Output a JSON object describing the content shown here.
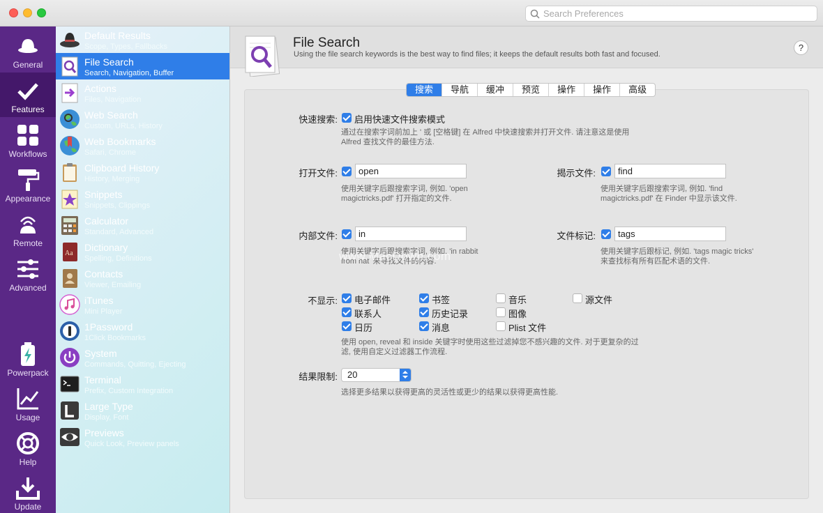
{
  "search": {
    "placeholder": "Search Preferences"
  },
  "leftbar": {
    "items": [
      {
        "label": "General",
        "icon": "hat-icon"
      },
      {
        "label": "Features",
        "icon": "checkmark-icon"
      },
      {
        "label": "Workflows",
        "icon": "grid-icon"
      },
      {
        "label": "Appearance",
        "icon": "paint-roller-icon"
      },
      {
        "label": "Remote",
        "icon": "remote-icon"
      },
      {
        "label": "Advanced",
        "icon": "sliders-icon"
      },
      {
        "label": "Powerpack",
        "icon": "battery-icon"
      },
      {
        "label": "Usage",
        "icon": "chart-icon"
      },
      {
        "label": "Help",
        "icon": "lifebuoy-icon"
      },
      {
        "label": "Update",
        "icon": "download-icon"
      }
    ]
  },
  "sidebar": {
    "items": [
      {
        "title": "Default Results",
        "sub": "Scope, Types, Fallbacks"
      },
      {
        "title": "File Search",
        "sub": "Search, Navigation, Buffer"
      },
      {
        "title": "Actions",
        "sub": "Files, Navigation"
      },
      {
        "title": "Web Search",
        "sub": "Custom, URLs, History"
      },
      {
        "title": "Web Bookmarks",
        "sub": "Safari, Chrome"
      },
      {
        "title": "Clipboard History",
        "sub": "History, Merging"
      },
      {
        "title": "Snippets",
        "sub": "Snippets, Clippings"
      },
      {
        "title": "Calculator",
        "sub": "Standard, Advanced"
      },
      {
        "title": "Dictionary",
        "sub": "Spelling, Definitions"
      },
      {
        "title": "Contacts",
        "sub": "Viewer, Emailing"
      },
      {
        "title": "iTunes",
        "sub": "Mini Player"
      },
      {
        "title": "1Password",
        "sub": "1Click Bookmarks"
      },
      {
        "title": "System",
        "sub": "Commands, Quitting, Ejecting"
      },
      {
        "title": "Terminal",
        "sub": "Prefix, Custom Integration"
      },
      {
        "title": "Large Type",
        "sub": "Display, Font"
      },
      {
        "title": "Previews",
        "sub": "Quick Look, Preview panels"
      }
    ]
  },
  "header": {
    "title": "File Search",
    "desc": "Using the file search keywords is the best way to find files; it keeps the default results both fast and focused.",
    "help": "?"
  },
  "tabs": [
    "搜索",
    "导航",
    "缓冲",
    "预览",
    "操作",
    "操作",
    "高级"
  ],
  "quick": {
    "label": "快速搜索:",
    "checkbox": "启用快速文件搜索模式",
    "hint1": "通过在搜索字词前加上 ' 或 [空格键] 在 Alfred 中快速搜索并打开文件. 请注意这是使用",
    "hint2": "Alfred 查找文件的最佳方法."
  },
  "open": {
    "label": "打开文件:",
    "value": "open",
    "hint1": "使用关键字后跟搜索字词, 例如. 'open",
    "hint2": "magictricks.pdf' 打开指定的文件."
  },
  "reveal": {
    "label": "揭示文件:",
    "value": "find",
    "hint1": "使用关键字后跟搜索字词, 例如. 'find",
    "hint2": "magictricks.pdf' 在 Finder 中显示该文件."
  },
  "inside": {
    "label": "内部文件:",
    "value": "in",
    "hint1": "使用关键字后跟搜索字词, 例如. 'in rabbit",
    "hint2": "from hat' 来寻找文件的内容."
  },
  "tags": {
    "label": "文件标记:",
    "value": "tags",
    "hint1": "使用关键字后跟标记, 例如. 'tags magic tricks'",
    "hint2": "来查找标有所有匹配术语的文件."
  },
  "exclude": {
    "label": "不显示:",
    "options": [
      {
        "text": "电子邮件",
        "checked": true
      },
      {
        "text": "书签",
        "checked": true
      },
      {
        "text": "音乐",
        "checked": false
      },
      {
        "text": "源文件",
        "checked": false
      },
      {
        "text": "联系人",
        "checked": true
      },
      {
        "text": "历史记录",
        "checked": true
      },
      {
        "text": "图像",
        "checked": false
      },
      {
        "text": "日历",
        "checked": true
      },
      {
        "text": "消息",
        "checked": true
      },
      {
        "text": "Plist 文件",
        "checked": false
      }
    ],
    "hint1": "使用 open, reveal 和 inside 关键字时使用这些过滤掉您不感兴趣的文件. 对于更复杂的过",
    "hint2": "滤, 使用自定义过滤器工作流程."
  },
  "limit": {
    "label": "结果限制:",
    "value": "20",
    "hint": "选择更多结果以获得更高的灵活性或更少的结果以获得更高性能."
  },
  "watermark": "www.MacDown.com"
}
